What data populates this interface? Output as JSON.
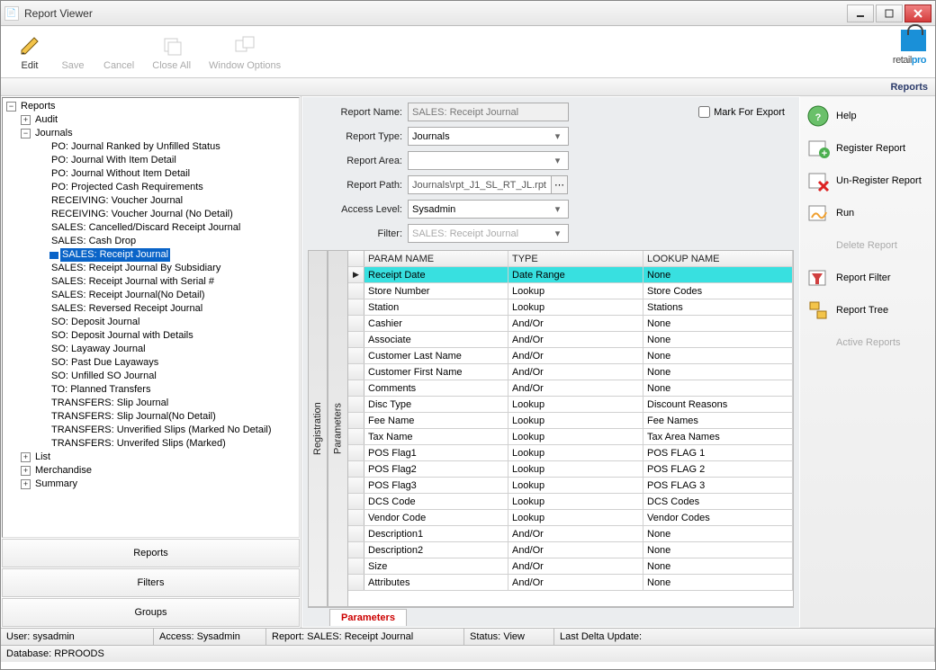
{
  "window": {
    "title": "Report Viewer"
  },
  "toolbar": {
    "edit": "Edit",
    "save": "Save",
    "cancel": "Cancel",
    "closeAll": "Close All",
    "windowOptions": "Window Options"
  },
  "logo": {
    "text_plain": "retail",
    "text_bold": "pro"
  },
  "breadcrumb": "Reports",
  "tree": {
    "root": "Reports",
    "audit": "Audit",
    "journals": "Journals",
    "journal_items": [
      "PO: Journal Ranked by Unfilled Status",
      "PO: Journal With Item Detail",
      "PO: Journal Without Item Detail",
      "PO: Projected Cash Requirements",
      "RECEIVING: Voucher Journal",
      "RECEIVING: Voucher Journal (No Detail)",
      "SALES: Cancelled/Discard Receipt Journal",
      "SALES: Cash Drop",
      "SALES: Receipt Journal",
      "SALES: Receipt Journal By Subsidiary",
      "SALES: Receipt Journal with Serial #",
      "SALES: Receipt Journal(No Detail)",
      "SALES: Reversed Receipt Journal",
      "SO: Deposit Journal",
      "SO: Deposit Journal with Details",
      "SO: Layaway Journal",
      "SO: Past Due Layaways",
      "SO: Unfilled SO Journal",
      "TO: Planned Transfers",
      "TRANSFERS: Slip Journal",
      "TRANSFERS: Slip Journal(No Detail)",
      "TRANSFERS: Unverified Slips (Marked No Detail)",
      "TRANSFERS: Unverifed Slips (Marked)"
    ],
    "selected_index": 8,
    "list": "List",
    "merchandise": "Merchandise",
    "summary": "Summary"
  },
  "nav": {
    "reports": "Reports",
    "filters": "Filters",
    "groups": "Groups"
  },
  "form": {
    "report_name_lbl": "Report Name:",
    "report_name": "SALES: Receipt Journal",
    "report_type_lbl": "Report Type:",
    "report_type": "Journals",
    "report_area_lbl": "Report Area:",
    "report_area": "",
    "report_path_lbl": "Report Path:",
    "report_path": "Journals\\rpt_J1_SL_RT_JL.rpt",
    "access_level_lbl": "Access Level:",
    "access_level": "Sysadmin",
    "filter_lbl": "Filter:",
    "filter": "SALES: Receipt Journal",
    "mark_export": "Mark For Export"
  },
  "grid": {
    "headers": [
      "PARAM NAME",
      "TYPE",
      "LOOKUP NAME"
    ],
    "rows": [
      [
        "Receipt Date",
        "Date Range",
        "None"
      ],
      [
        "Store Number",
        "Lookup",
        "Store Codes"
      ],
      [
        "Station",
        "Lookup",
        "Stations"
      ],
      [
        "Cashier",
        "And/Or",
        "None"
      ],
      [
        "Associate",
        "And/Or",
        "None"
      ],
      [
        "Customer Last Name",
        "And/Or",
        "None"
      ],
      [
        "Customer First Name",
        "And/Or",
        "None"
      ],
      [
        "Comments",
        "And/Or",
        "None"
      ],
      [
        "Disc Type",
        "Lookup",
        "Discount Reasons"
      ],
      [
        "Fee Name",
        "Lookup",
        "Fee Names"
      ],
      [
        "Tax Name",
        "Lookup",
        "Tax Area Names"
      ],
      [
        "POS Flag1",
        "Lookup",
        "POS FLAG 1"
      ],
      [
        "POS Flag2",
        "Lookup",
        "POS FLAG 2"
      ],
      [
        "POS Flag3",
        "Lookup",
        "POS FLAG 3"
      ],
      [
        "DCS Code",
        "Lookup",
        "DCS Codes"
      ],
      [
        "Vendor Code",
        "Lookup",
        "Vendor Codes"
      ],
      [
        "Description1",
        "And/Or",
        "None"
      ],
      [
        "Description2",
        "And/Or",
        "None"
      ],
      [
        "Size",
        "And/Or",
        "None"
      ],
      [
        "Attributes",
        "And/Or",
        "None"
      ]
    ],
    "selected_row": 0,
    "tab": "Parameters",
    "vtab_reg": "Registration",
    "vtab_par": "Parameters"
  },
  "actions": {
    "help": "Help",
    "register": "Register Report",
    "unregister": "Un-Register Report",
    "run": "Run",
    "delete": "Delete Report",
    "filter": "Report Filter",
    "tree": "Report Tree",
    "active": "Active Reports"
  },
  "status1": {
    "user_lbl": "User:",
    "user": "sysadmin",
    "access_lbl": "Access:",
    "access": "Sysadmin",
    "report_lbl": "Report:",
    "report": "SALES: Receipt Journal",
    "status_lbl": "Status:",
    "status": "View",
    "delta_lbl": "Last Delta Update:",
    "delta": ""
  },
  "status2": {
    "db_lbl": "Database:",
    "db": "RPROODS"
  }
}
